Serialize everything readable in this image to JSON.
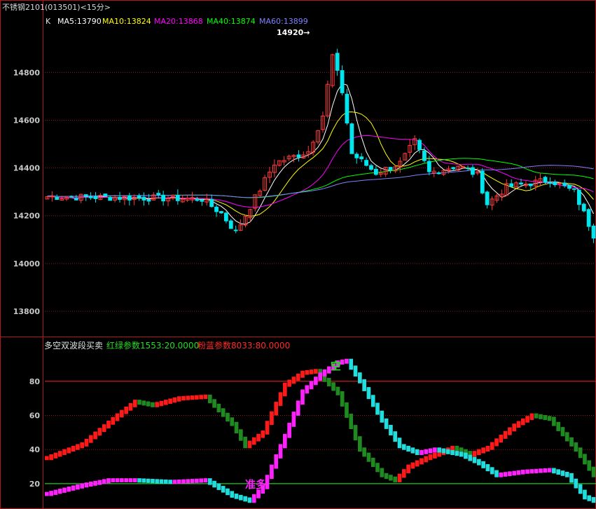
{
  "title": "不锈钢2101(013501)<15分>",
  "colors": {
    "background": "#000000",
    "frame": "#b01818",
    "grid": "#8a1c1c",
    "axis_text": "#c8c8c8",
    "up_candle": "#ff3a3a",
    "down_candle": "#00e5ee",
    "ma5": "#ffffff",
    "ma10": "#ffff00",
    "ma20": "#ff00ff",
    "ma40": "#00ff00",
    "ma60": "#8080ff",
    "red_green_up": "#ff1a1a",
    "red_green_down": "#1f8a1f",
    "pink_blue_up": "#ff22ff",
    "pink_blue_down": "#22dddd",
    "level_80": "#ff2020",
    "level_20": "#20ff20"
  },
  "price_panel": {
    "label_k": "K",
    "legend": [
      {
        "name": "MA5",
        "value": "13790",
        "color": "#ffffff"
      },
      {
        "name": "MA10",
        "value": "13824",
        "color": "#ffff00"
      },
      {
        "name": "MA20",
        "value": "13868",
        "color": "#ff00ff"
      },
      {
        "name": "MA40",
        "value": "13874",
        "color": "#00ff00"
      },
      {
        "name": "MA60",
        "value": "13899",
        "color": "#8080ff"
      }
    ],
    "peak_label": "14920→",
    "ylim": [
      13700,
      14980
    ],
    "yticks": [
      14800,
      14600,
      14400,
      14200,
      14000,
      13800
    ]
  },
  "indicator_panel": {
    "title": "多空双波段买卖",
    "param_red_green": "红绿参数1553:20.0000",
    "param_pink_blue": "粉蓝参数8033:80.0000",
    "ylim": [
      6,
      98
    ],
    "yticks": [
      80,
      60,
      40,
      20
    ],
    "levels": [
      80,
      20
    ],
    "annotation_short": "空",
    "annotation_long": "准多"
  },
  "chart_data": {
    "type": "candlestick",
    "bar_count": 98,
    "price_range_visible": [
      14060,
      14920
    ],
    "price_key_points": [
      {
        "bar": 0,
        "close": 14280
      },
      {
        "bar": 20,
        "close": 14275
      },
      {
        "bar": 32,
        "close": 14270
      },
      {
        "bar": 36,
        "close": 14210
      },
      {
        "bar": 39,
        "close": 14130
      },
      {
        "bar": 47,
        "close": 14420
      },
      {
        "bar": 54,
        "close": 14470
      },
      {
        "bar": 57,
        "close": 14620
      },
      {
        "bar": 59,
        "close": 14870
      },
      {
        "bar": 61,
        "close": 14720
      },
      {
        "bar": 63,
        "close": 14460
      },
      {
        "bar": 68,
        "close": 14380
      },
      {
        "bar": 73,
        "close": 14420
      },
      {
        "bar": 76,
        "close": 14510
      },
      {
        "bar": 79,
        "close": 14380
      },
      {
        "bar": 85,
        "close": 14410
      },
      {
        "bar": 89,
        "close": 14370
      },
      {
        "bar": 91,
        "close": 14250
      },
      {
        "bar": 95,
        "close": 14320
      },
      {
        "bar": 104,
        "close": 14350
      },
      {
        "bar": 109,
        "close": 14300
      },
      {
        "bar": 113,
        "close": 14120
      }
    ],
    "red_green_key_points": [
      {
        "bar": 0,
        "value": 35
      },
      {
        "bar": 8,
        "value": 43
      },
      {
        "bar": 16,
        "value": 60
      },
      {
        "bar": 20,
        "value": 68
      },
      {
        "bar": 24,
        "value": 66
      },
      {
        "bar": 30,
        "value": 70
      },
      {
        "bar": 36,
        "value": 71
      },
      {
        "bar": 42,
        "value": 55
      },
      {
        "bar": 45,
        "value": 42
      },
      {
        "bar": 49,
        "value": 50
      },
      {
        "bar": 54,
        "value": 78
      },
      {
        "bar": 58,
        "value": 85
      },
      {
        "bar": 61,
        "value": 86
      },
      {
        "bar": 66,
        "value": 73
      },
      {
        "bar": 71,
        "value": 40
      },
      {
        "bar": 76,
        "value": 25
      },
      {
        "bar": 79,
        "value": 22
      },
      {
        "bar": 82,
        "value": 30
      },
      {
        "bar": 86,
        "value": 35
      },
      {
        "bar": 88,
        "value": 37
      },
      {
        "bar": 92,
        "value": 41
      },
      {
        "bar": 96,
        "value": 37
      },
      {
        "bar": 100,
        "value": 41
      },
      {
        "bar": 106,
        "value": 54
      },
      {
        "bar": 110,
        "value": 60
      },
      {
        "bar": 114,
        "value": 58
      },
      {
        "bar": 120,
        "value": 40
      },
      {
        "bar": 124,
        "value": 25
      }
    ],
    "pink_blue_key_points": [
      {
        "bar": 0,
        "value": 14
      },
      {
        "bar": 8,
        "value": 19
      },
      {
        "bar": 14,
        "value": 22
      },
      {
        "bar": 20,
        "value": 22
      },
      {
        "bar": 28,
        "value": 21
      },
      {
        "bar": 36,
        "value": 22
      },
      {
        "bar": 42,
        "value": 13
      },
      {
        "bar": 46,
        "value": 10
      },
      {
        "bar": 49,
        "value": 18
      },
      {
        "bar": 54,
        "value": 48
      },
      {
        "bar": 58,
        "value": 74
      },
      {
        "bar": 62,
        "value": 84
      },
      {
        "bar": 66,
        "value": 91
      },
      {
        "bar": 68,
        "value": 92
      },
      {
        "bar": 71,
        "value": 80
      },
      {
        "bar": 76,
        "value": 57
      },
      {
        "bar": 80,
        "value": 42
      },
      {
        "bar": 84,
        "value": 38
      },
      {
        "bar": 88,
        "value": 40
      },
      {
        "bar": 94,
        "value": 37
      },
      {
        "bar": 98,
        "value": 32
      },
      {
        "bar": 102,
        "value": 25
      },
      {
        "bar": 108,
        "value": 27
      },
      {
        "bar": 114,
        "value": 28
      },
      {
        "bar": 118,
        "value": 25
      },
      {
        "bar": 122,
        "value": 12
      },
      {
        "bar": 124,
        "value": 10
      }
    ]
  }
}
